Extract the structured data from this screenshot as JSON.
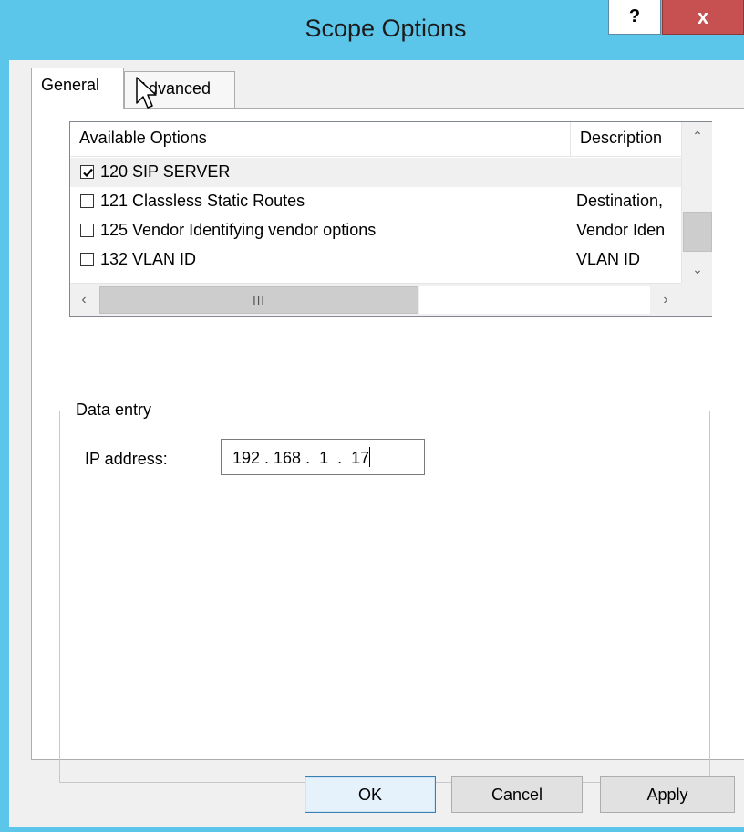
{
  "window": {
    "title": "Scope Options",
    "help_label": "?",
    "close_label": "x",
    "titlebar_color": "#5bc6ea",
    "close_color": "#c75050"
  },
  "tabs": [
    {
      "label": "General",
      "active": true
    },
    {
      "label": "Advanced",
      "active": false
    }
  ],
  "options_list": {
    "columns": [
      "Available Options",
      "Description"
    ],
    "rows": [
      {
        "name": "120 SIP SERVER",
        "description": "",
        "checked": true
      },
      {
        "name": "121 Classless Static Routes",
        "description": "Destination,",
        "checked": false
      },
      {
        "name": "125 Vendor Identifying vendor options",
        "description": "Vendor Iden",
        "checked": false
      },
      {
        "name": "132 VLAN ID",
        "description": "VLAN ID",
        "checked": false
      }
    ],
    "hscroll_thumb_grip": "III"
  },
  "data_entry": {
    "legend": "Data entry",
    "ip_label": "IP address:",
    "ip_value": "192 . 168 .  1  .  17"
  },
  "buttons": {
    "ok": "OK",
    "cancel": "Cancel",
    "apply": "Apply"
  }
}
